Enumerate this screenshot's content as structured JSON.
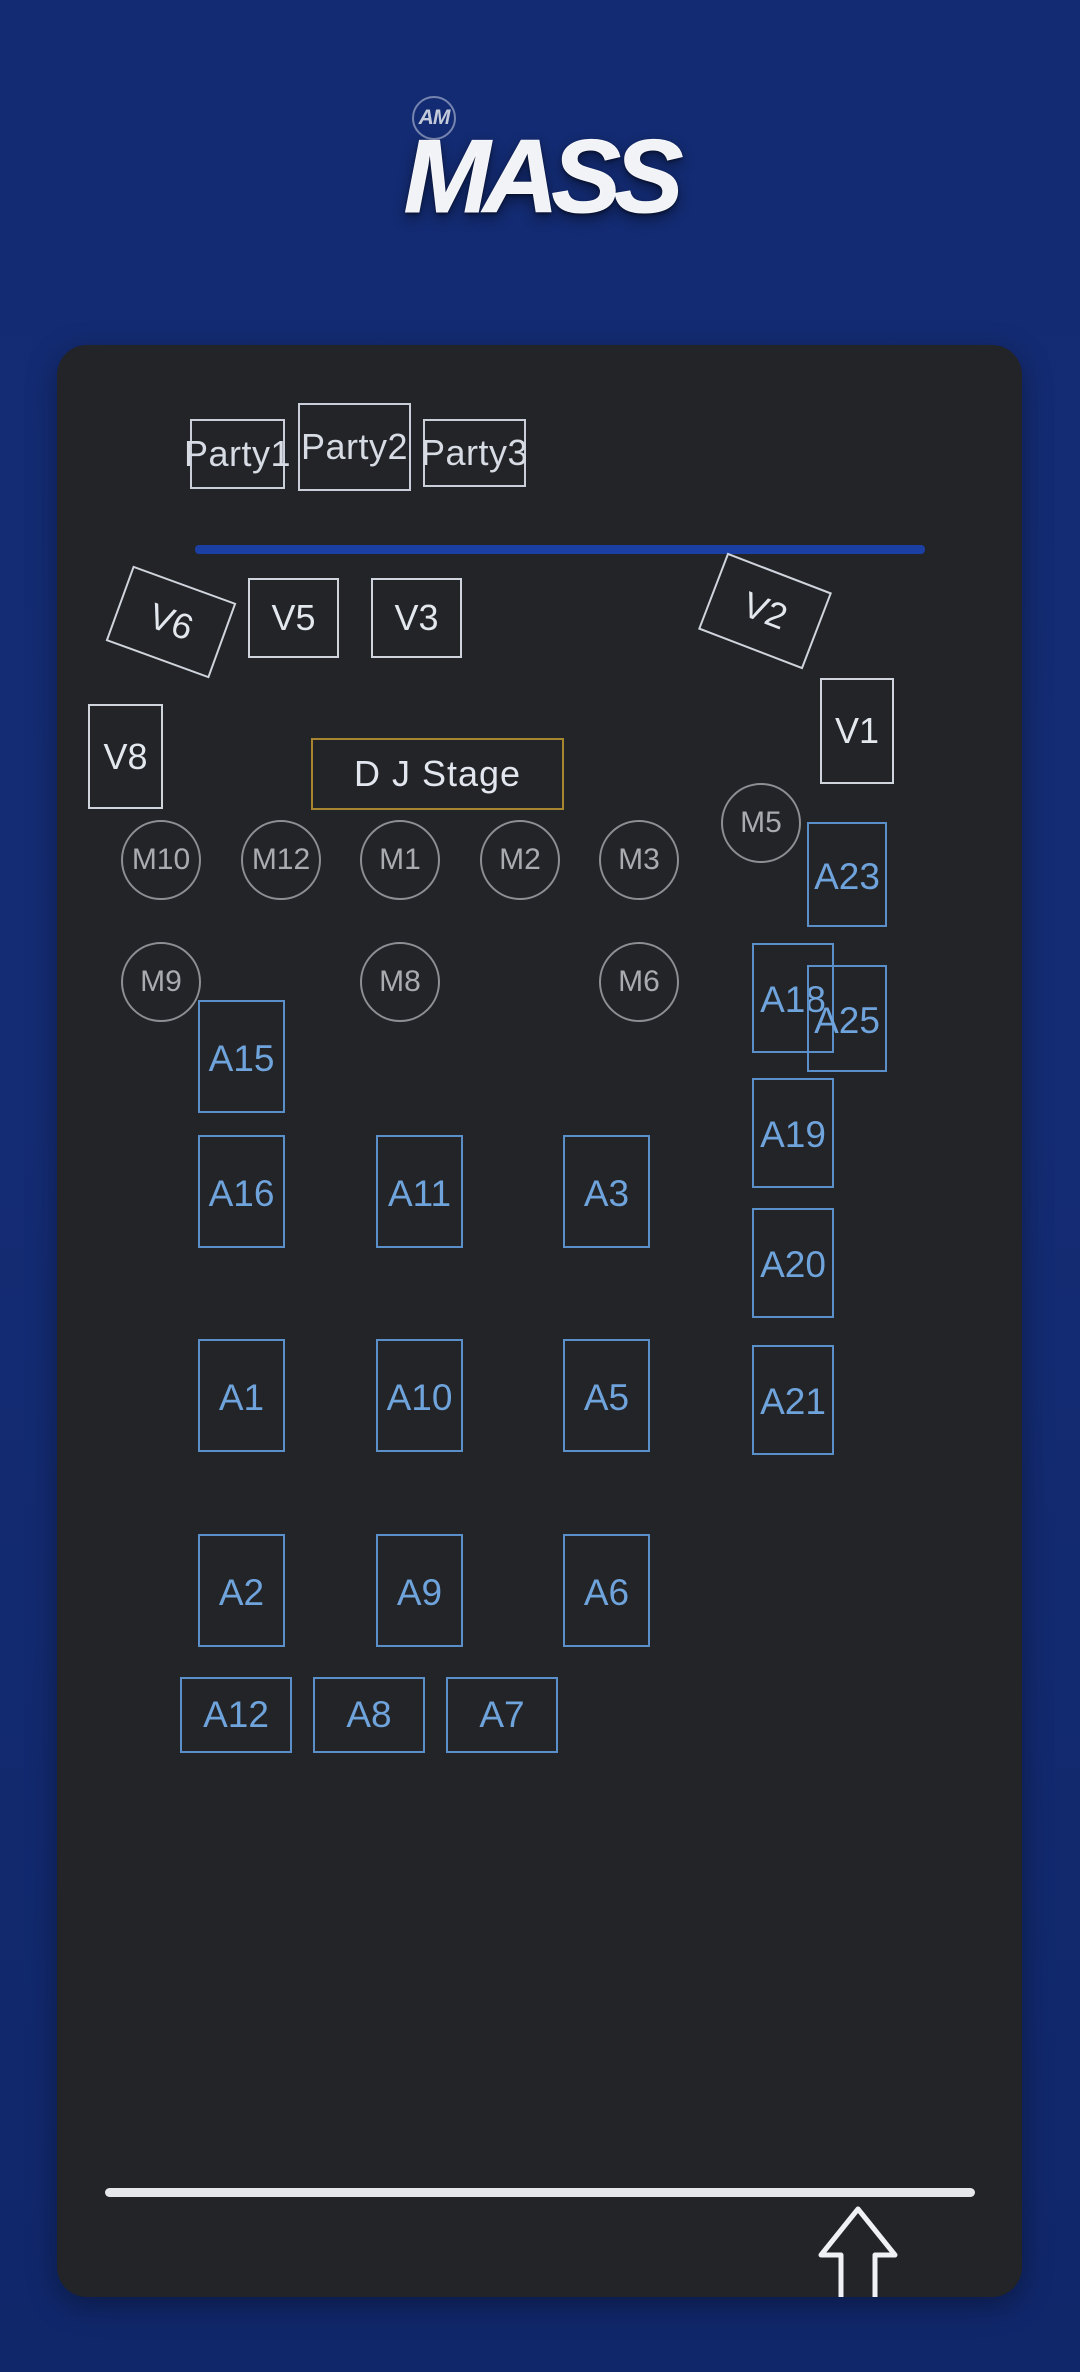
{
  "brand": {
    "monogram": "AM",
    "wordmark": "MASS"
  },
  "colors": {
    "page_background": "#132b72",
    "card_background": "#232427",
    "divider_blue": "#1b3fa3",
    "a_table_blue": "#6fa3dc",
    "m_table_gray": "#a9abb0",
    "v_room_white": "#e3e7ee",
    "dj_stage_gold": "#a8862f"
  },
  "party_tabs": [
    {
      "label": "Party1"
    },
    {
      "label": "Party2"
    },
    {
      "label": "Party3"
    }
  ],
  "dj_stage": {
    "label": "D J Stage"
  },
  "v_rooms": [
    {
      "label": "V6"
    },
    {
      "label": "V5"
    },
    {
      "label": "V3"
    },
    {
      "label": "V2"
    },
    {
      "label": "V8"
    },
    {
      "label": "V1"
    }
  ],
  "m_tables": [
    {
      "label": "M10"
    },
    {
      "label": "M12"
    },
    {
      "label": "M1"
    },
    {
      "label": "M2"
    },
    {
      "label": "M3"
    },
    {
      "label": "M5"
    },
    {
      "label": "M9"
    },
    {
      "label": "M8"
    },
    {
      "label": "M6"
    }
  ],
  "a_tables": [
    {
      "label": "A23"
    },
    {
      "label": "A18"
    },
    {
      "label": "A25"
    },
    {
      "label": "A19"
    },
    {
      "label": "A20"
    },
    {
      "label": "A21"
    },
    {
      "label": "A15"
    },
    {
      "label": "A16"
    },
    {
      "label": "A11"
    },
    {
      "label": "A3"
    },
    {
      "label": "A1"
    },
    {
      "label": "A10"
    },
    {
      "label": "A5"
    },
    {
      "label": "A2"
    },
    {
      "label": "A9"
    },
    {
      "label": "A6"
    },
    {
      "label": "A12"
    },
    {
      "label": "A8"
    },
    {
      "label": "A7"
    }
  ],
  "icons": {
    "exit_arrow": "up-arrow-icon",
    "home_indicator": "home-indicator"
  }
}
